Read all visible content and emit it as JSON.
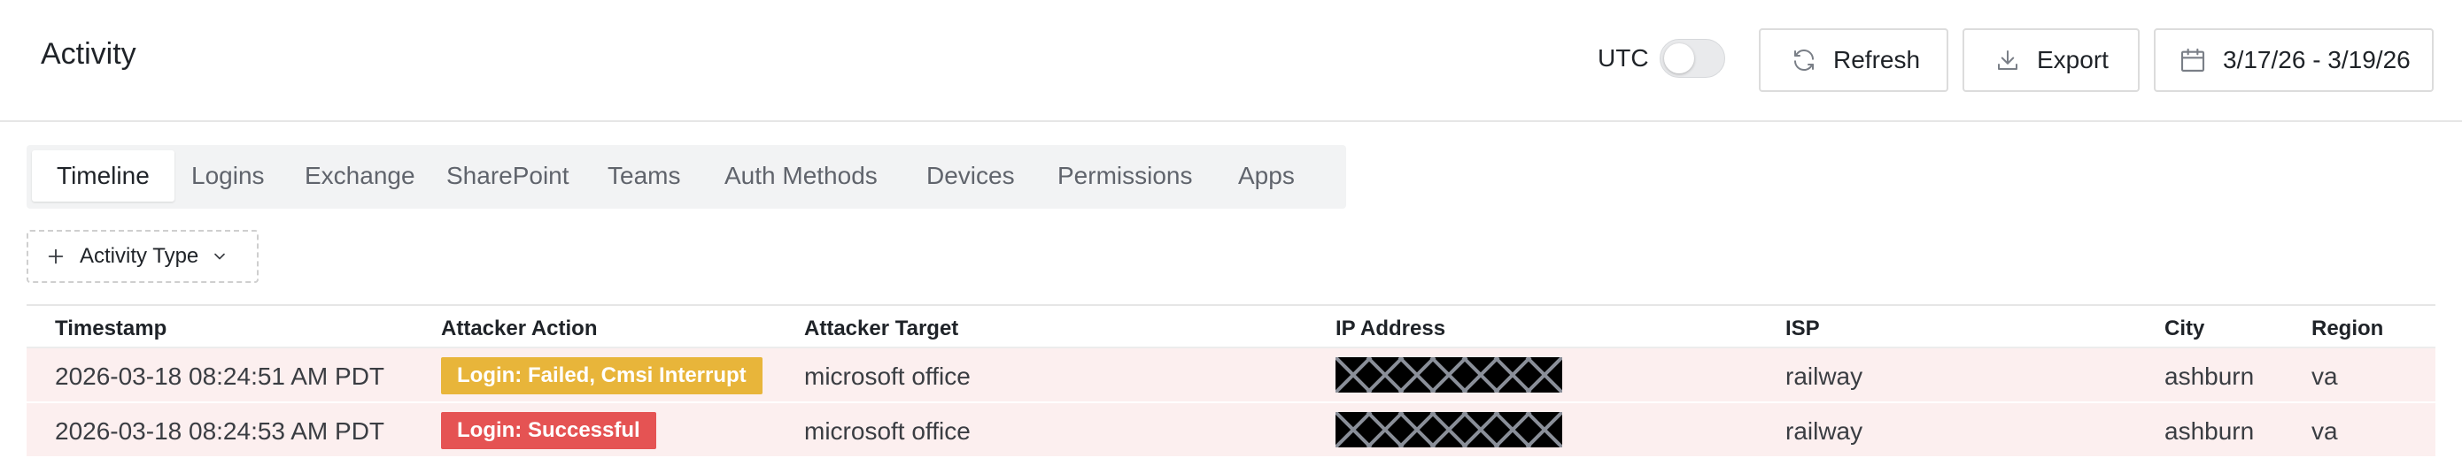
{
  "header": {
    "title": "Activity",
    "utc_label": "UTC",
    "utc_enabled": false,
    "refresh_label": "Refresh",
    "export_label": "Export",
    "date_range": "3/17/26 - 3/19/26"
  },
  "tabs": [
    {
      "label": "Timeline",
      "active": true
    },
    {
      "label": "Logins",
      "active": false
    },
    {
      "label": "Exchange",
      "active": false
    },
    {
      "label": "SharePoint",
      "active": false
    },
    {
      "label": "Teams",
      "active": false
    },
    {
      "label": "Auth Methods",
      "active": false
    },
    {
      "label": "Devices",
      "active": false
    },
    {
      "label": "Permissions",
      "active": false
    },
    {
      "label": "Apps",
      "active": false
    }
  ],
  "filter": {
    "label": "Activity Type"
  },
  "table": {
    "columns": [
      "Timestamp",
      "Attacker Action",
      "Attacker Target",
      "IP Address",
      "ISP",
      "City",
      "Region"
    ],
    "rows": [
      {
        "timestamp": "2026-03-18 08:24:51 AM PDT",
        "action": "Login: Failed, Cmsi Interrupt",
        "action_color": "#e8b53a",
        "target": "microsoft office",
        "isp": "railway",
        "city": "ashburn",
        "region": "va"
      },
      {
        "timestamp": "2026-03-18 08:24:53 AM PDT",
        "action": "Login: Successful",
        "action_color": "#e55353",
        "target": "microsoft office",
        "isp": "railway",
        "city": "ashburn",
        "region": "va"
      }
    ]
  },
  "colors": {
    "row_bg": "#fcefef",
    "warning_badge": "#e8b53a",
    "danger_badge": "#e55353",
    "tab_bar_bg": "#f2f3f4"
  }
}
